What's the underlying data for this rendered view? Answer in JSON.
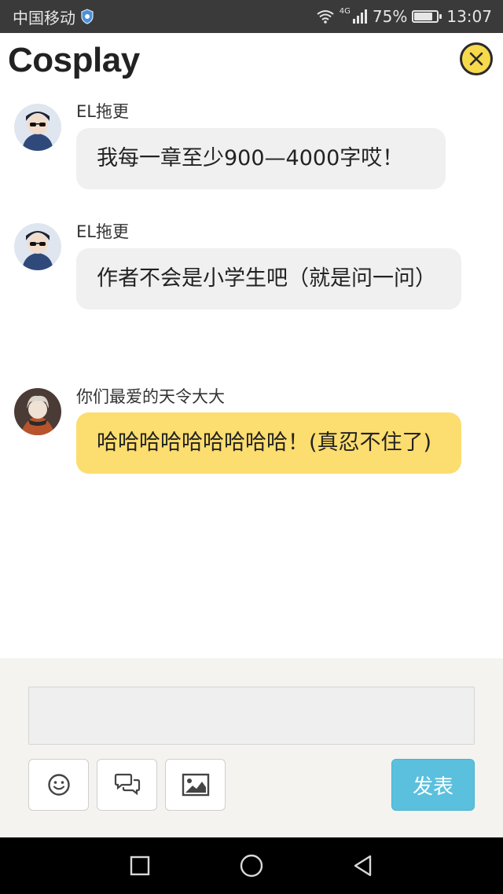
{
  "status_bar": {
    "carrier": "中国移动",
    "network": "4G",
    "battery": "75%",
    "battery_level": 0.75,
    "time": "13:07"
  },
  "header": {
    "title": "Cosplay",
    "close_icon": "close-circle-icon"
  },
  "messages": [
    {
      "sender": "EL拖更",
      "text": "我每一章至少900—4000字哎！",
      "highlighted": false
    },
    {
      "sender": "EL拖更",
      "text": "作者不会是小学生吧（就是问一问）",
      "highlighted": false
    },
    {
      "sender": "你们最爱的天令大大",
      "text": "哈哈哈哈哈哈哈哈哈！(真忍不住了)",
      "highlighted": true
    }
  ],
  "composer": {
    "input_value": "",
    "tools": [
      "smile-icon",
      "comments-icon",
      "image-icon"
    ],
    "send_label": "发表"
  },
  "colors": {
    "status_bar": "#3a3a3a",
    "bubble": "#f0f0f0",
    "bubble_highlight": "#fcdd6f",
    "send_button": "#5bc0de",
    "close_button": "#f7d94c"
  }
}
